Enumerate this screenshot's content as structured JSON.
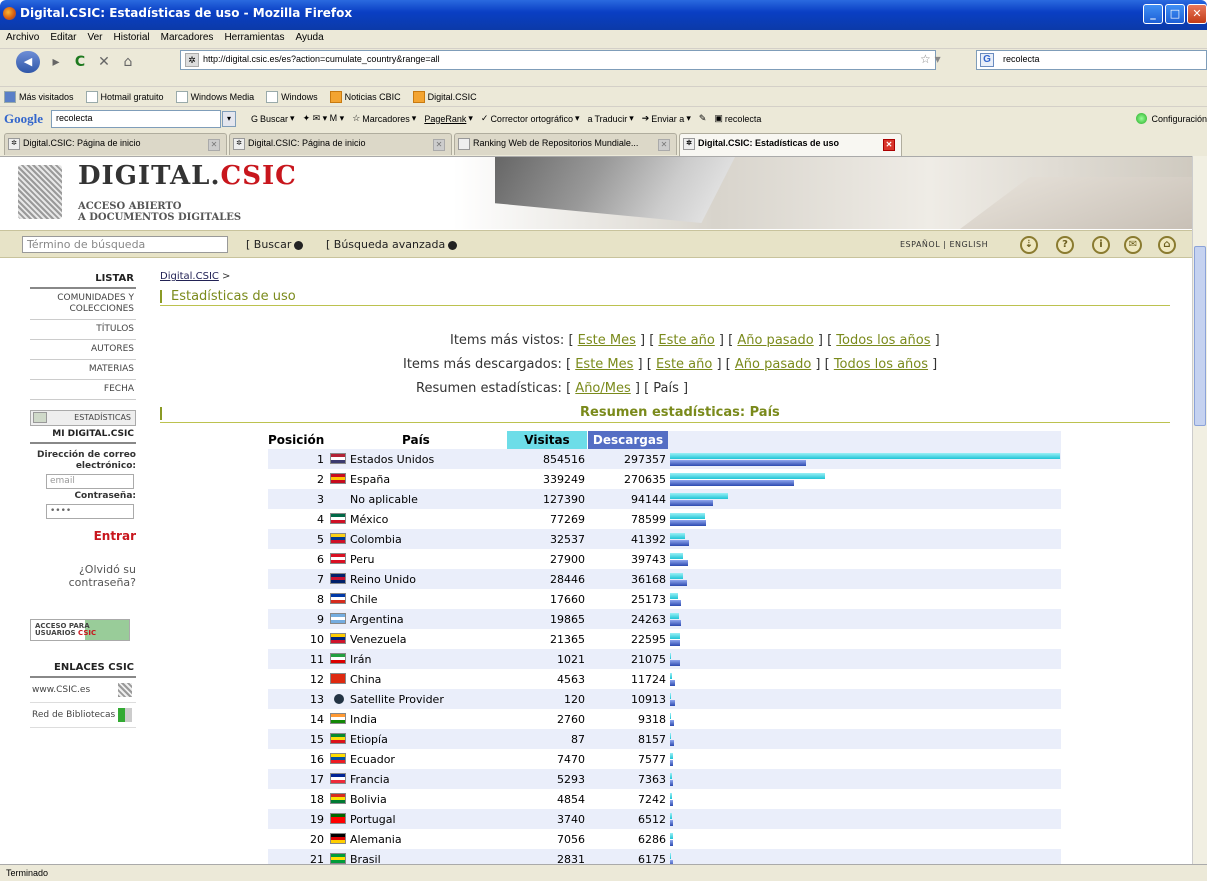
{
  "window": {
    "title": "Digital.CSIC: Estadísticas de uso - Mozilla Firefox"
  },
  "menu": [
    "Archivo",
    "Editar",
    "Ver",
    "Historial",
    "Marcadores",
    "Herramientas",
    "Ayuda"
  ],
  "address": {
    "url": "http://digital.csic.es/es?action=cumulate_country&range=all"
  },
  "search_engine": {
    "value": "recolecta"
  },
  "bookmarks": [
    "Más visitados",
    "Hotmail gratuito",
    "Windows Media",
    "Windows",
    "Noticias CBIC",
    "Digital.CSIC"
  ],
  "google_toolbar": {
    "query": "recolecta",
    "items": [
      "Buscar",
      "Marcadores",
      "PageRank",
      "Corrector ortográfico",
      "Traducir",
      "Enviar a",
      "recolecta"
    ],
    "config": "Configuración"
  },
  "tabs": [
    {
      "label": "Digital.CSIC: Página de inicio"
    },
    {
      "label": "Digital.CSIC: Página de inicio"
    },
    {
      "label": "Ranking Web de Repositorios Mundiale..."
    },
    {
      "label": "Digital.CSIC: Estadísticas de uso"
    }
  ],
  "site": {
    "logo_a": "DIGITAL.",
    "logo_b": "CSIC",
    "subtitle1": "ACCESO ABIERTO",
    "subtitle2": "A DOCUMENTOS DIGITALES",
    "search_placeholder": "Término de búsqueda",
    "buscar": "[ Buscar",
    "avanzada": "[ Búsqueda avanzada",
    "lang": "ESPAÑOL | ENGLISH"
  },
  "sidebar": {
    "listar": "LISTAR",
    "items": [
      "COMUNIDADES Y COLECCIONES",
      "TÍTULOS",
      "AUTORES",
      "MATERIAS",
      "FECHA"
    ],
    "estadisticas": "ESTADÍSTICAS",
    "mi": "MI DIGITAL.CSIC",
    "email_label": "Dirección de correo electrónico:",
    "email_placeholder": "email",
    "pass_label": "Contraseña:",
    "pass_value": "••••",
    "entrar": "Entrar",
    "olvido": "¿Olvidó su contraseña?",
    "acceso1": "ACCESO PARA",
    "acceso2": "USUARIOS",
    "acceso3": "CSIC",
    "enlaces": "ENLACES CSIC",
    "link1": "www.CSIC.es",
    "link2": "Red de Bibliotecas"
  },
  "main": {
    "crumb": "Digital.CSIC",
    "crumb_sep": " >",
    "title": "Estadísticas de uso",
    "vistos_label": "Items más vistos:",
    "descargados_label": "Items más descargados:",
    "resumen_label": "Resumen estadísticas:",
    "links": [
      "Este Mes",
      "Este año",
      "Año pasado",
      "Todos los años"
    ],
    "anomes": "Año/Mes",
    "pais": "País",
    "section": "Resumen estadísticas: País"
  },
  "table": {
    "headers": {
      "pos": "Posición",
      "pais": "País",
      "vis": "Visitas",
      "des": "Descargas"
    },
    "rows": [
      {
        "pos": "1",
        "pais": "Estados Unidos",
        "vis": "854516",
        "des": "297357",
        "flag": [
          "#b22234",
          "#fff",
          "#3c3b6e"
        ]
      },
      {
        "pos": "2",
        "pais": "España",
        "vis": "339249",
        "des": "270635",
        "flag": [
          "#c60b1e",
          "#ffc400",
          "#c60b1e"
        ]
      },
      {
        "pos": "3",
        "pais": "No aplicable",
        "vis": "127390",
        "des": "94144",
        "flag": null
      },
      {
        "pos": "4",
        "pais": "México",
        "vis": "77269",
        "des": "78599",
        "flag": [
          "#006847",
          "#fff",
          "#ce1126"
        ]
      },
      {
        "pos": "5",
        "pais": "Colombia",
        "vis": "32537",
        "des": "41392",
        "flag": [
          "#fcd116",
          "#003893",
          "#ce1126"
        ]
      },
      {
        "pos": "6",
        "pais": "Peru",
        "vis": "27900",
        "des": "39743",
        "flag": [
          "#d91023",
          "#fff",
          "#d91023"
        ]
      },
      {
        "pos": "7",
        "pais": "Reino Unido",
        "vis": "28446",
        "des": "36168",
        "flag": [
          "#012169",
          "#c8102e",
          "#012169"
        ]
      },
      {
        "pos": "8",
        "pais": "Chile",
        "vis": "17660",
        "des": "25173",
        "flag": [
          "#0039a6",
          "#fff",
          "#d52b1e"
        ]
      },
      {
        "pos": "9",
        "pais": "Argentina",
        "vis": "19865",
        "des": "24263",
        "flag": [
          "#74acdf",
          "#fff",
          "#74acdf"
        ]
      },
      {
        "pos": "10",
        "pais": "Venezuela",
        "vis": "21365",
        "des": "22595",
        "flag": [
          "#ffcc00",
          "#00247d",
          "#cf142b"
        ]
      },
      {
        "pos": "11",
        "pais": "Irán",
        "vis": "1021",
        "des": "21075",
        "flag": [
          "#239f40",
          "#fff",
          "#da0000"
        ]
      },
      {
        "pos": "12",
        "pais": "China",
        "vis": "4563",
        "des": "11724",
        "flag": [
          "#de2910",
          "#de2910",
          "#de2910"
        ]
      },
      {
        "pos": "13",
        "pais": "Satellite Provider",
        "vis": "120",
        "des": "10913",
        "flag": null
      },
      {
        "pos": "14",
        "pais": "India",
        "vis": "2760",
        "des": "9318",
        "flag": [
          "#ff9933",
          "#fff",
          "#138808"
        ]
      },
      {
        "pos": "15",
        "pais": "Etiopía",
        "vis": "87",
        "des": "8157",
        "flag": [
          "#078930",
          "#fcdd09",
          "#da121a"
        ]
      },
      {
        "pos": "16",
        "pais": "Ecuador",
        "vis": "7470",
        "des": "7577",
        "flag": [
          "#ffdd00",
          "#034ea2",
          "#ed1c24"
        ]
      },
      {
        "pos": "17",
        "pais": "Francia",
        "vis": "5293",
        "des": "7363",
        "flag": [
          "#002395",
          "#fff",
          "#ed2939"
        ]
      },
      {
        "pos": "18",
        "pais": "Bolivia",
        "vis": "4854",
        "des": "7242",
        "flag": [
          "#d52b1e",
          "#f9e300",
          "#007934"
        ]
      },
      {
        "pos": "19",
        "pais": "Portugal",
        "vis": "3740",
        "des": "6512",
        "flag": [
          "#006600",
          "#ff0000",
          "#ff0000"
        ]
      },
      {
        "pos": "20",
        "pais": "Alemania",
        "vis": "7056",
        "des": "6286",
        "flag": [
          "#000",
          "#dd0000",
          "#ffce00"
        ]
      },
      {
        "pos": "21",
        "pais": "Brasil",
        "vis": "2831",
        "des": "6175",
        "flag": [
          "#009c3b",
          "#ffdf00",
          "#009c3b"
        ]
      }
    ],
    "max_value": 854516
  },
  "status": "Terminado"
}
